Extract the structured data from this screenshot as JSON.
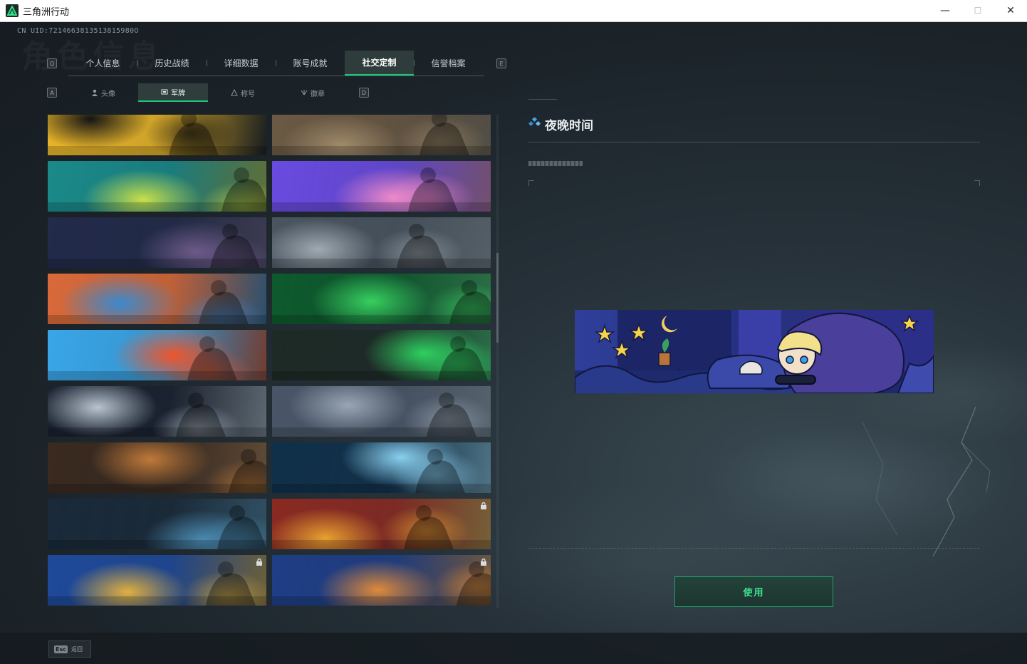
{
  "window": {
    "title": "三角洲行动",
    "controls": [
      "—",
      "☐",
      "✕"
    ]
  },
  "profile": {
    "uid": "CN UID:7214663813513815980O",
    "bg_title": "角色信息"
  },
  "main_tabs": {
    "left_key": "Q",
    "right_key": "E",
    "items": [
      {
        "label": "个人信息",
        "active": false
      },
      {
        "label": "历史战绩",
        "active": false
      },
      {
        "label": "详细数据",
        "active": false
      },
      {
        "label": "账号成就",
        "active": false
      },
      {
        "label": "社交定制",
        "active": true
      },
      {
        "label": "信誉档案",
        "active": false
      }
    ]
  },
  "sub_tabs": {
    "left_key": "A",
    "right_key": "D",
    "items": [
      {
        "label": "头像",
        "icon": "person-icon",
        "active": false
      },
      {
        "label": "军牌",
        "icon": "tag-icon",
        "active": true
      },
      {
        "label": "称号",
        "icon": "title-icon",
        "active": false
      },
      {
        "label": "徽章",
        "icon": "badge-icon",
        "active": false
      }
    ]
  },
  "banners": [
    {
      "theme": "yellow-graffiti",
      "locked": false,
      "c1": "#e8b52a",
      "c2": "#141414"
    },
    {
      "theme": "desert-dust",
      "locked": false,
      "c1": "#6b5a44",
      "c2": "#a08a6a"
    },
    {
      "theme": "neon-sketch",
      "locked": false,
      "c1": "#1b8a8a",
      "c2": "#c8e04a"
    },
    {
      "theme": "anime-pink-blue",
      "locked": false,
      "c1": "#6a4be0",
      "c2": "#ef8ac8"
    },
    {
      "theme": "night-battle",
      "locked": false,
      "c1": "#222b4a",
      "c2": "#6c5a88"
    },
    {
      "theme": "jet-pilot",
      "locked": false,
      "c1": "#4a5560",
      "c2": "#a0aab2"
    },
    {
      "theme": "desert-atv",
      "locked": false,
      "c1": "#d96a3a",
      "c2": "#3a8ad0"
    },
    {
      "theme": "green-flame",
      "locked": false,
      "c1": "#0e5a2e",
      "c2": "#38d060"
    },
    {
      "theme": "fries-cartoon",
      "locked": false,
      "c1": "#3aa6e8",
      "c2": "#f0552a"
    },
    {
      "theme": "signature-green",
      "locked": false,
      "c1": "#1e2a26",
      "c2": "#2fd060"
    },
    {
      "theme": "astronaut-moon",
      "locked": false,
      "c1": "#1a2230",
      "c2": "#b8c4d0"
    },
    {
      "theme": "city-soldier",
      "locked": false,
      "c1": "#4a5668",
      "c2": "#9aa6b4"
    },
    {
      "theme": "knife-fighter",
      "locked": false,
      "c1": "#3a2a20",
      "c2": "#c07a3a"
    },
    {
      "theme": "axe-ice",
      "locked": false,
      "c1": "#10304a",
      "c2": "#8ad0f0"
    },
    {
      "theme": "blade-neon",
      "locked": false,
      "c1": "#1a2a3a",
      "c2": "#4a8ab0"
    },
    {
      "theme": "explosion-gun",
      "locked": true,
      "c1": "#8a2a22",
      "c2": "#e8a030"
    },
    {
      "theme": "gingerbread-bow",
      "locked": true,
      "c1": "#1f4a9a",
      "c2": "#e0b040"
    },
    {
      "theme": "orange-jets",
      "locked": true,
      "c1": "#1f3e86",
      "c2": "#e08a3a"
    },
    {
      "theme": "green-partial",
      "locked": true,
      "c1": "#2a6a3a",
      "c2": "#80d050"
    },
    {
      "theme": "red-partial",
      "locked": true,
      "c1": "#c0402a",
      "c2": "#f0a070"
    }
  ],
  "detail": {
    "title": "夜晚时间",
    "action_label": "使用"
  },
  "footer": {
    "esc_key": "Esc",
    "esc_label": "返回"
  },
  "colors": {
    "accent": "#1ec77e",
    "bg": "#1b2126"
  }
}
